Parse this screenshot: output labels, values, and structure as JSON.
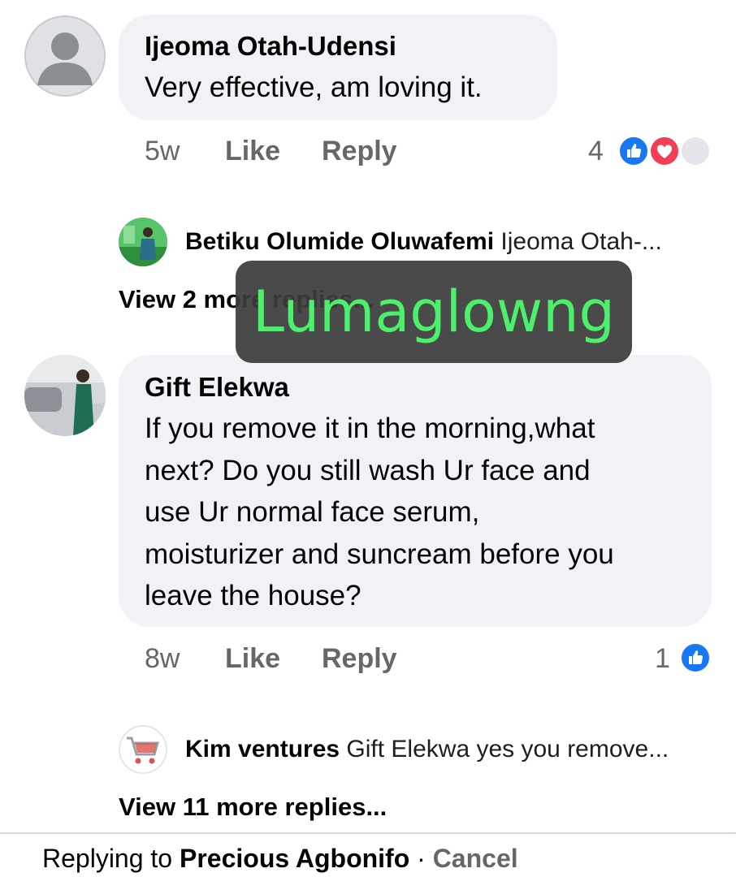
{
  "comments": [
    {
      "author": "Ijeoma Otah-Udensi",
      "text_lines": [
        "Very effective, am loving it."
      ],
      "time": "5w",
      "like_label": "Like",
      "reply_label": "Reply",
      "reaction_count": "4",
      "reactions": [
        "like-icon",
        "love-icon",
        "other-reaction-icon"
      ],
      "reply_preview": {
        "name": "Betiku Olumide Oluwafemi",
        "text": "Ijeoma Otah-..."
      },
      "view_more": "View 2 more replies..."
    },
    {
      "author": "Gift Elekwa",
      "text_lines": [
        "If you remove it in the morning,what",
        "next? Do you still wash Ur face and",
        "use Ur normal face serum,",
        "moisturizer and suncream before you",
        "leave the house?"
      ],
      "time": "8w",
      "like_label": "Like",
      "reply_label": "Reply",
      "reaction_count": "1",
      "reactions": [
        "like-icon"
      ],
      "reply_preview": {
        "name": "Kim ventures",
        "text": "Gift Elekwa yes you remove..."
      },
      "view_more": "View 11 more replies..."
    }
  ],
  "watermark": "Lumaglowng",
  "footer": {
    "prefix": "Replying to",
    "name": "Precious Agbonifo",
    "separator": "·",
    "cancel": "Cancel"
  },
  "colors": {
    "bubble": "#f0f2f5",
    "secondary_text": "#65676b",
    "like_blue": "#1877f2",
    "love_red": "#f33e58",
    "watermark_text": "#4cf06a"
  }
}
